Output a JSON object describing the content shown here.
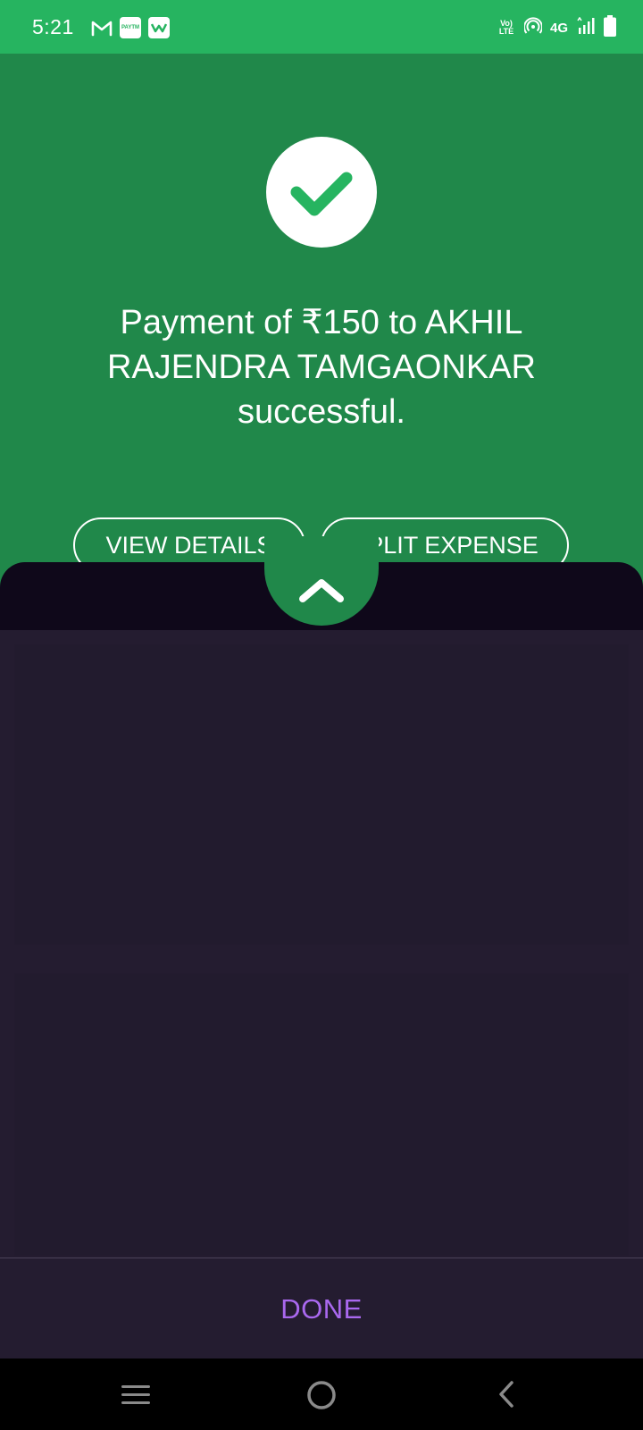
{
  "status_bar": {
    "time": "5:21",
    "app_icons": [
      "gmail-icon",
      "paytm-icon",
      "app-notification-icon"
    ],
    "paytm_label": "PAYTM",
    "volte_label": "Vo) LTE",
    "network_label": "4G",
    "right_icons": [
      "hotspot-icon",
      "signal-icon",
      "battery-icon"
    ]
  },
  "success": {
    "icon": "checkmark-icon",
    "message": "Payment of ₹150 to AKHIL RAJENDRA TAMGAONKAR successful.",
    "view_details_label": "VIEW DETAILS",
    "split_expense_label": "SPLIT EXPENSE"
  },
  "sheet": {
    "handle_icon": "chevron-up-icon"
  },
  "footer": {
    "done_label": "DONE"
  },
  "navigation": {
    "icons": [
      "menu-icon",
      "home-icon",
      "back-icon"
    ]
  },
  "colors": {
    "status_bar": "#26b460",
    "success_bg": "#20884a",
    "sheet_bg": "#0f081a",
    "panel_bg": "#221b2e",
    "page_bg": "#241c30",
    "done_text": "#a968ee",
    "check": "#26b460"
  }
}
